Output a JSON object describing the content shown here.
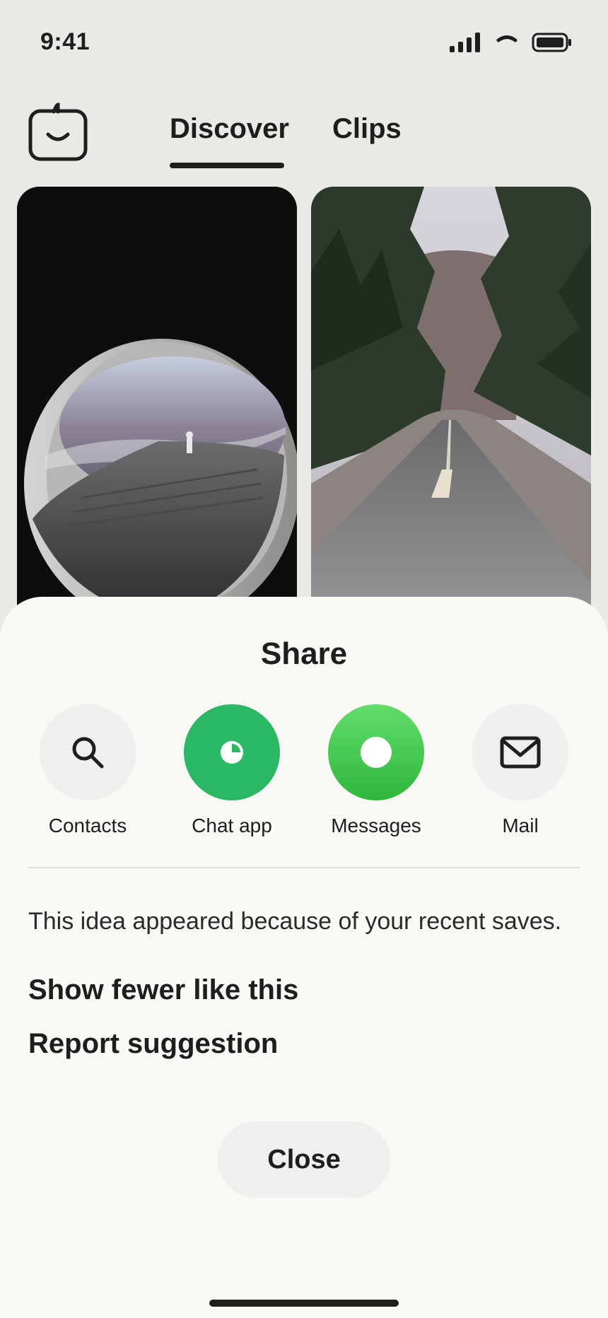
{
  "status_bar": {
    "time": "9:41",
    "signal_icon": "cellular-signal-icon",
    "wifi_icon": "wifi-icon",
    "battery_icon": "battery-icon"
  },
  "nav": {
    "logo_icon": "app-logo-icon",
    "tabs": [
      {
        "label": "Discover",
        "active": true
      },
      {
        "label": "Clips",
        "active": false
      }
    ]
  },
  "feed": {
    "cards": [
      {
        "subject": "curved concrete tunnel opening to cloudy sky"
      },
      {
        "subject": "forest road with center line"
      }
    ]
  },
  "share_sheet": {
    "title": "Share",
    "targets": [
      {
        "label": "Contacts",
        "icon": "search-icon",
        "color": "#efefed"
      },
      {
        "label": "Chat app",
        "icon": "chat-app-icon",
        "color": "#2bb865"
      },
      {
        "label": "Messages",
        "icon": "messages-icon",
        "color": "#3cc44a"
      },
      {
        "label": "Mail",
        "icon": "mail-icon",
        "color": "#efefed"
      }
    ],
    "reason": "This idea appeared because of your recent saves.",
    "actions": {
      "show_fewer": "Show fewer like this",
      "report": "Report suggestion"
    },
    "close_label": "Close"
  },
  "colors": {
    "background": "#e9e9e6",
    "sheet": "#f9f8f5",
    "text": "#1e1e1e"
  }
}
